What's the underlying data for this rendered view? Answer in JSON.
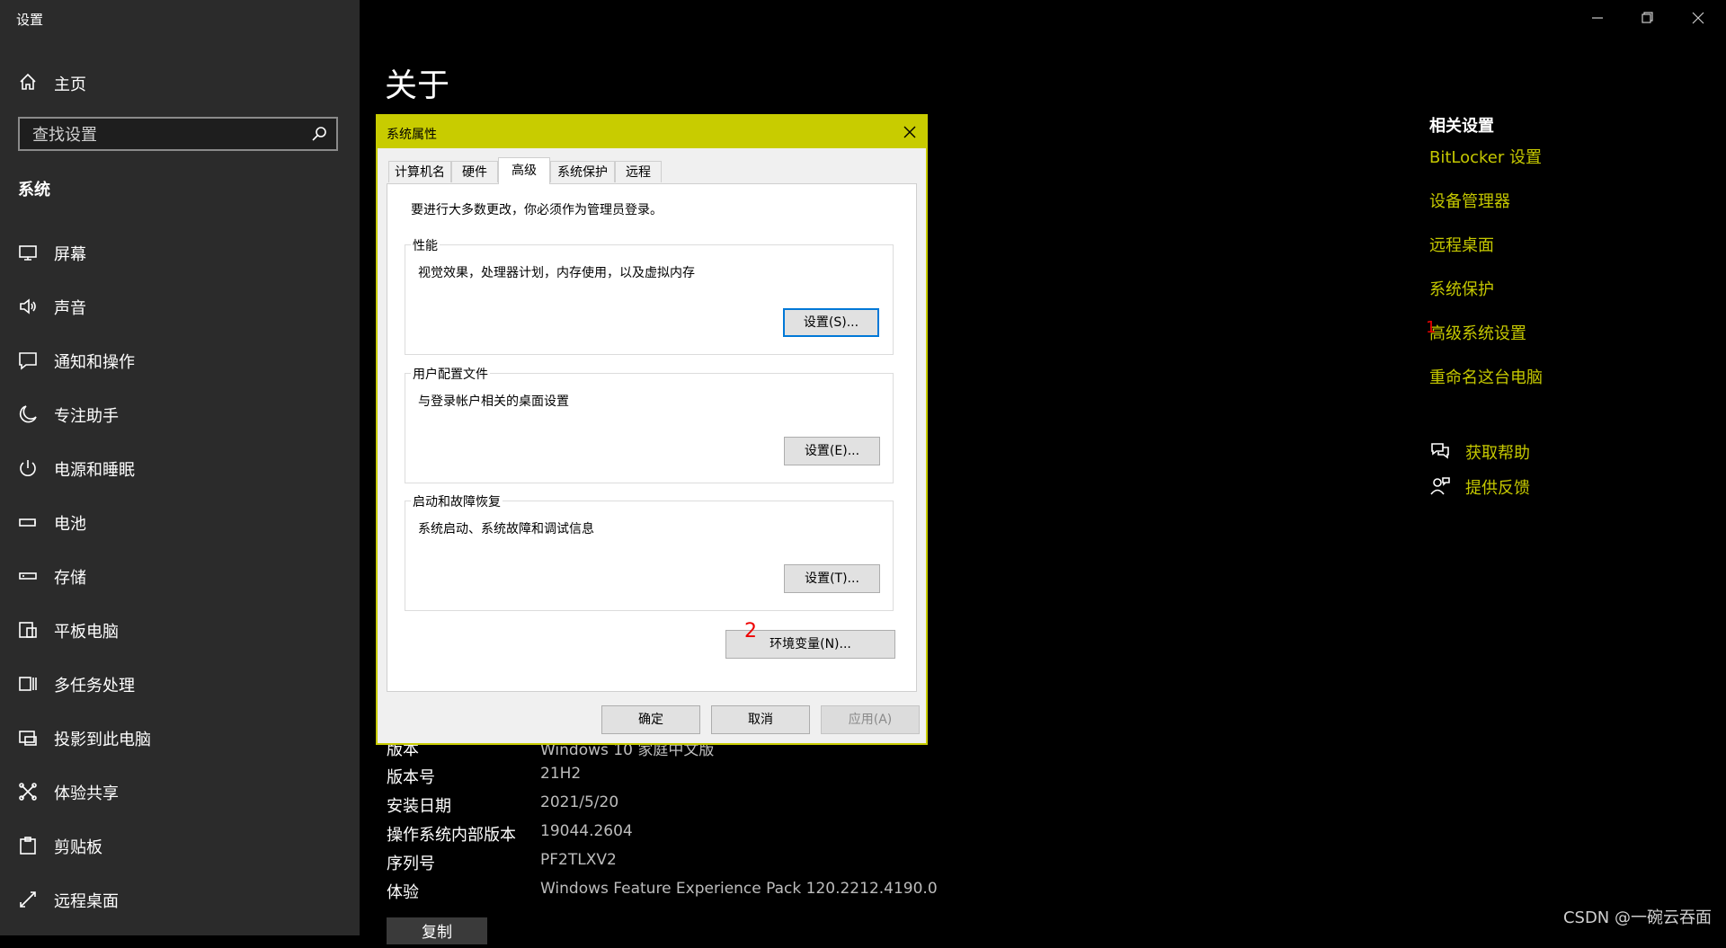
{
  "app": {
    "title": "设置"
  },
  "sidebar": {
    "home_label": "主页",
    "search_placeholder": "查找设置",
    "section": "系统",
    "items": [
      {
        "label": "屏幕",
        "icon": "display-icon"
      },
      {
        "label": "声音",
        "icon": "speaker-icon"
      },
      {
        "label": "通知和操作",
        "icon": "notification-icon"
      },
      {
        "label": "专注助手",
        "icon": "moon-icon"
      },
      {
        "label": "电源和睡眠",
        "icon": "power-icon"
      },
      {
        "label": "电池",
        "icon": "battery-icon"
      },
      {
        "label": "存储",
        "icon": "storage-icon"
      },
      {
        "label": "平板电脑",
        "icon": "tablet-icon"
      },
      {
        "label": "多任务处理",
        "icon": "multitask-icon"
      },
      {
        "label": "投影到此电脑",
        "icon": "project-icon"
      },
      {
        "label": "体验共享",
        "icon": "share-icon"
      },
      {
        "label": "剪贴板",
        "icon": "clipboard-icon"
      },
      {
        "label": "远程桌面",
        "icon": "remote-icon"
      }
    ]
  },
  "main": {
    "title": "关于",
    "specs": [
      {
        "label": "版本",
        "value": "Windows 10 家庭中文版"
      },
      {
        "label": "版本号",
        "value": "21H2"
      },
      {
        "label": "安装日期",
        "value": "2021/5/20"
      },
      {
        "label": "操作系统内部版本",
        "value": "19044.2604"
      },
      {
        "label": "序列号",
        "value": "PF2TLXV2"
      },
      {
        "label": "体验",
        "value": "Windows Feature Experience Pack 120.2212.4190.0"
      }
    ],
    "copy_label": "复制"
  },
  "related": {
    "title": "相关设置",
    "links": [
      "BitLocker 设置",
      "设备管理器",
      "远程桌面",
      "系统保护",
      "高级系统设置",
      "重命名这台电脑"
    ],
    "help": "获取帮助",
    "feedback": "提供反馈"
  },
  "annotations": {
    "mark1": "1",
    "mark2": "2"
  },
  "watermark": "CSDN @一碗云吞面",
  "dialog": {
    "title": "系统属性",
    "tabs": [
      "计算机名",
      "硬件",
      "高级",
      "系统保护",
      "远程"
    ],
    "active_tab": "高级",
    "admin_note": "要进行大多数更改，你必须作为管理员登录。",
    "groups": [
      {
        "title": "性能",
        "desc": "视觉效果，处理器计划，内存使用，以及虚拟内存",
        "button": "设置(S)..."
      },
      {
        "title": "用户配置文件",
        "desc": "与登录帐户相关的桌面设置",
        "button": "设置(E)..."
      },
      {
        "title": "启动和故障恢复",
        "desc": "系统启动、系统故障和调试信息",
        "button": "设置(T)..."
      }
    ],
    "env_button": "环境变量(N)...",
    "ok": "确定",
    "cancel": "取消",
    "apply": "应用(A)"
  },
  "colors": {
    "accent": "#c8cc00",
    "sidebar_bg": "#2b2b2b",
    "main_bg": "#000000",
    "annotation": "#e00000"
  }
}
